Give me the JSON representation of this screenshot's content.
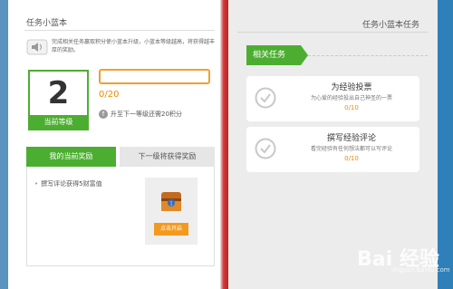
{
  "left_page": {
    "title": "任务小蓝本",
    "intro": "完成相关任务赢取积分使小蓝本升级，小蓝本等级越高，将获得越丰厚的奖励。",
    "level": {
      "number": "2",
      "label": "当前等级"
    },
    "progress": {
      "value": 0,
      "max": 20,
      "text": "0/20"
    },
    "upgrade_hint": "升至下一等级还需20积分",
    "tabs": {
      "current": "我的当前奖励",
      "next": "下一级将获得奖励"
    },
    "reward_item": "撰写评论获得5财富值",
    "open_button": "点击开启"
  },
  "right_page": {
    "title": "任务小蓝本任务",
    "section": "相关任务",
    "tasks": [
      {
        "title": "为经验投票",
        "desc": "为心爱的经验投出自己神圣的一票",
        "count": "0/10"
      },
      {
        "title": "撰写经验评论",
        "desc": "看完经验有任何想法都可以写评论",
        "count": "0/10"
      }
    ]
  },
  "watermark": {
    "text": "Bai 经验",
    "sub": "jingyan.baidu.com"
  },
  "colors": {
    "accent_green": "#4cae31",
    "accent_orange": "#f08a00",
    "spine_red": "#d53b3b",
    "frame_blue": "#3f8fc4"
  }
}
